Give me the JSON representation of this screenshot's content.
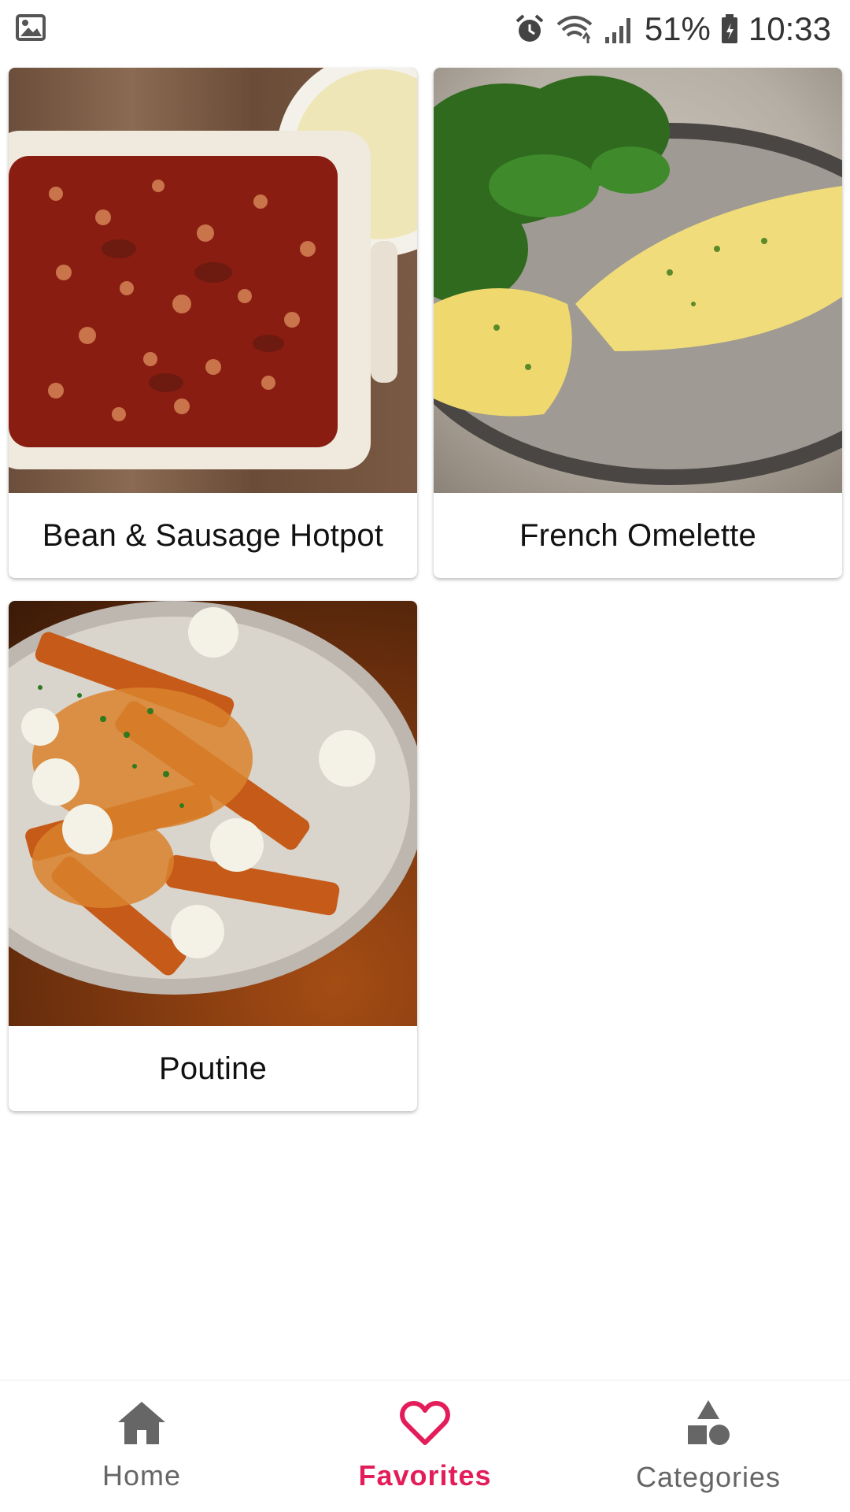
{
  "status_bar": {
    "battery_percent": "51%",
    "time": "10:33",
    "icons": [
      "gallery-icon",
      "alarm-icon",
      "wifi-icon",
      "signal-icon",
      "battery-icon"
    ]
  },
  "recipes": [
    {
      "title": "Bean & Sausage Hotpot"
    },
    {
      "title": "French Omelette"
    },
    {
      "title": "Poutine"
    }
  ],
  "bottom_nav": {
    "active": "favorites",
    "active_color": "#e31d5a",
    "items": [
      {
        "label": "Home",
        "icon": "home-icon"
      },
      {
        "label": "Favorites",
        "icon": "heart-icon"
      },
      {
        "label": "Categories",
        "icon": "shapes-icon"
      }
    ]
  }
}
